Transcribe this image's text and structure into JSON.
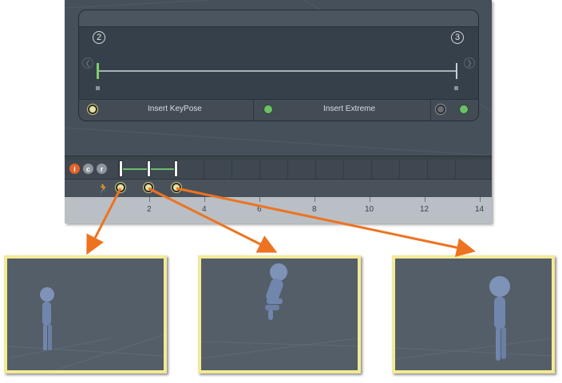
{
  "panel": {
    "key_start": "2",
    "key_end": "3",
    "insert_keypose_label": "Insert KeyPose",
    "insert_extreme_label": "Insert Extreme"
  },
  "timeline": {
    "buttons": [
      {
        "label": "i",
        "color": "#e4622a"
      },
      {
        "label": "c",
        "color": "#8e959c"
      },
      {
        "label": "r",
        "color": "#8e959c"
      }
    ],
    "ruler_labels": [
      "2",
      "4",
      "6",
      "8",
      "10",
      "12",
      "14"
    ]
  },
  "viewports": [
    {
      "pose": "standing-small-side"
    },
    {
      "pose": "jumping-tucked"
    },
    {
      "pose": "standing-close-side"
    }
  ],
  "colors": {
    "accent_orange": "#ee7320",
    "viewport_border": "#f3ea95",
    "key_green": "#6dbf6a",
    "key_cream": "#e6e1a8"
  }
}
